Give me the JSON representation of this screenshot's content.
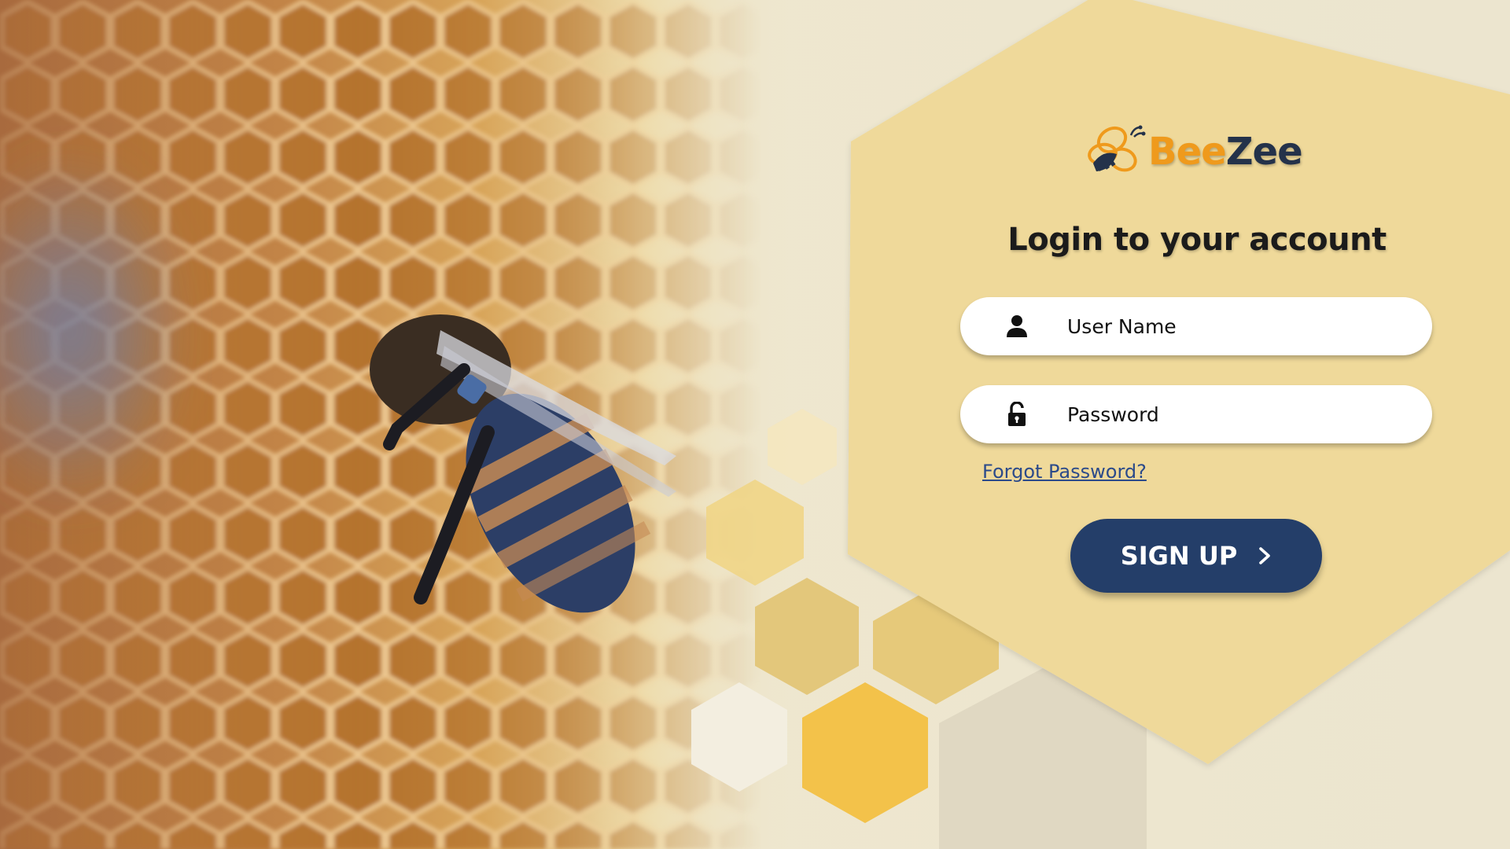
{
  "brand": {
    "name_part1": "Bee",
    "name_part2": "Zee",
    "logo_icon": "bee-logo-icon"
  },
  "login": {
    "title": "Login to your account",
    "username": {
      "placeholder": "User Name",
      "value": "",
      "icon": "user-icon"
    },
    "password": {
      "placeholder": "Password",
      "value": "",
      "icon": "unlock-icon"
    },
    "forgot_link": "Forgot Password?",
    "submit": {
      "label": "SIGN UP",
      "icon": "chevron-right-icon"
    }
  },
  "colors": {
    "panel": "#efd99a",
    "button": "#243e69",
    "link": "#2b4a8a",
    "brand_orange": "#ef9a1c",
    "brand_navy": "#24324a"
  }
}
